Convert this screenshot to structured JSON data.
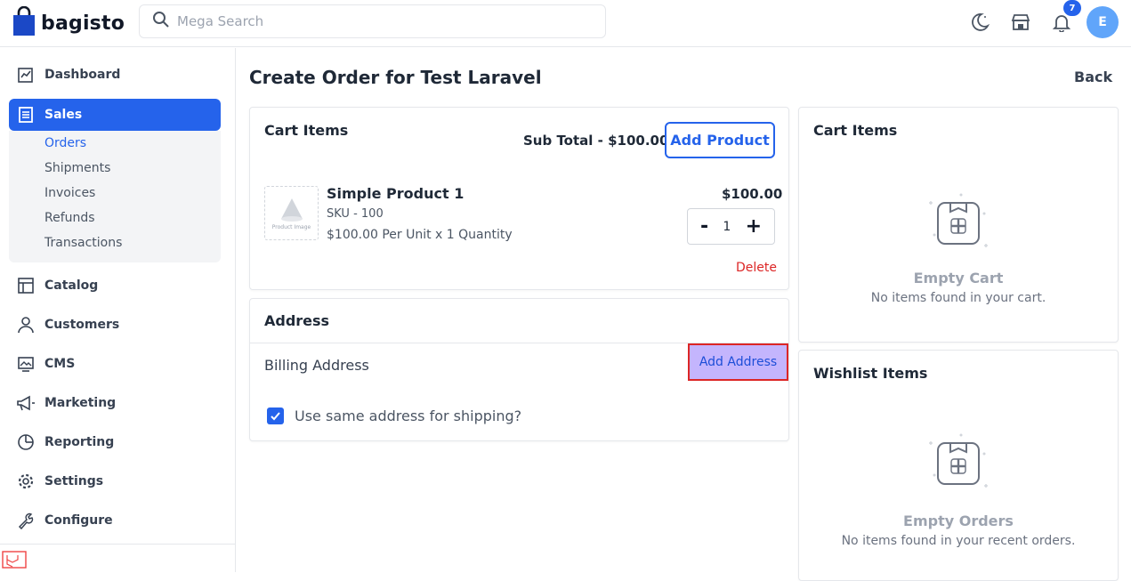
{
  "app": {
    "logo_text": "bagisto"
  },
  "search": {
    "placeholder": "Mega Search"
  },
  "header": {
    "notification_count": "7",
    "avatar_initial": "E"
  },
  "sidebar": {
    "items": [
      {
        "label": "Dashboard"
      },
      {
        "label": "Sales"
      },
      {
        "label": "Catalog"
      },
      {
        "label": "Customers"
      },
      {
        "label": "CMS"
      },
      {
        "label": "Marketing"
      },
      {
        "label": "Reporting"
      },
      {
        "label": "Settings"
      },
      {
        "label": "Configure"
      }
    ],
    "sales_sub": [
      {
        "label": "Orders"
      },
      {
        "label": "Shipments"
      },
      {
        "label": "Invoices"
      },
      {
        "label": "Refunds"
      },
      {
        "label": "Transactions"
      }
    ]
  },
  "page": {
    "title": "Create Order for Test Laravel",
    "back_label": "Back"
  },
  "cart": {
    "title": "Cart Items",
    "subtotal": "Sub Total - $100.00",
    "add_product_label": "Add Product",
    "item": {
      "image_label": "Product Image",
      "name": "Simple Product 1",
      "sku": "SKU - 100",
      "unit_info": "$100.00 Per Unit x 1 Quantity",
      "price": "$100.00",
      "qty": "1",
      "minus": "-",
      "plus": "+",
      "delete_label": "Delete"
    }
  },
  "address": {
    "title": "Address",
    "billing_label": "Billing Address",
    "add_address_label": "Add Address",
    "same_shipping_label": "Use same address for shipping?",
    "same_shipping_checked": true
  },
  "right_cart": {
    "title": "Cart Items",
    "empty_title": "Empty Cart",
    "empty_sub": "No items found in your cart."
  },
  "wishlist": {
    "title": "Wishlist Items",
    "empty_title": "Empty Orders",
    "empty_sub": "No items found in your recent orders."
  },
  "colors": {
    "primary": "#2563eb",
    "danger": "#dc2626",
    "highlight_fill": "#c4b5fd",
    "highlight_border": "#dc2626"
  }
}
